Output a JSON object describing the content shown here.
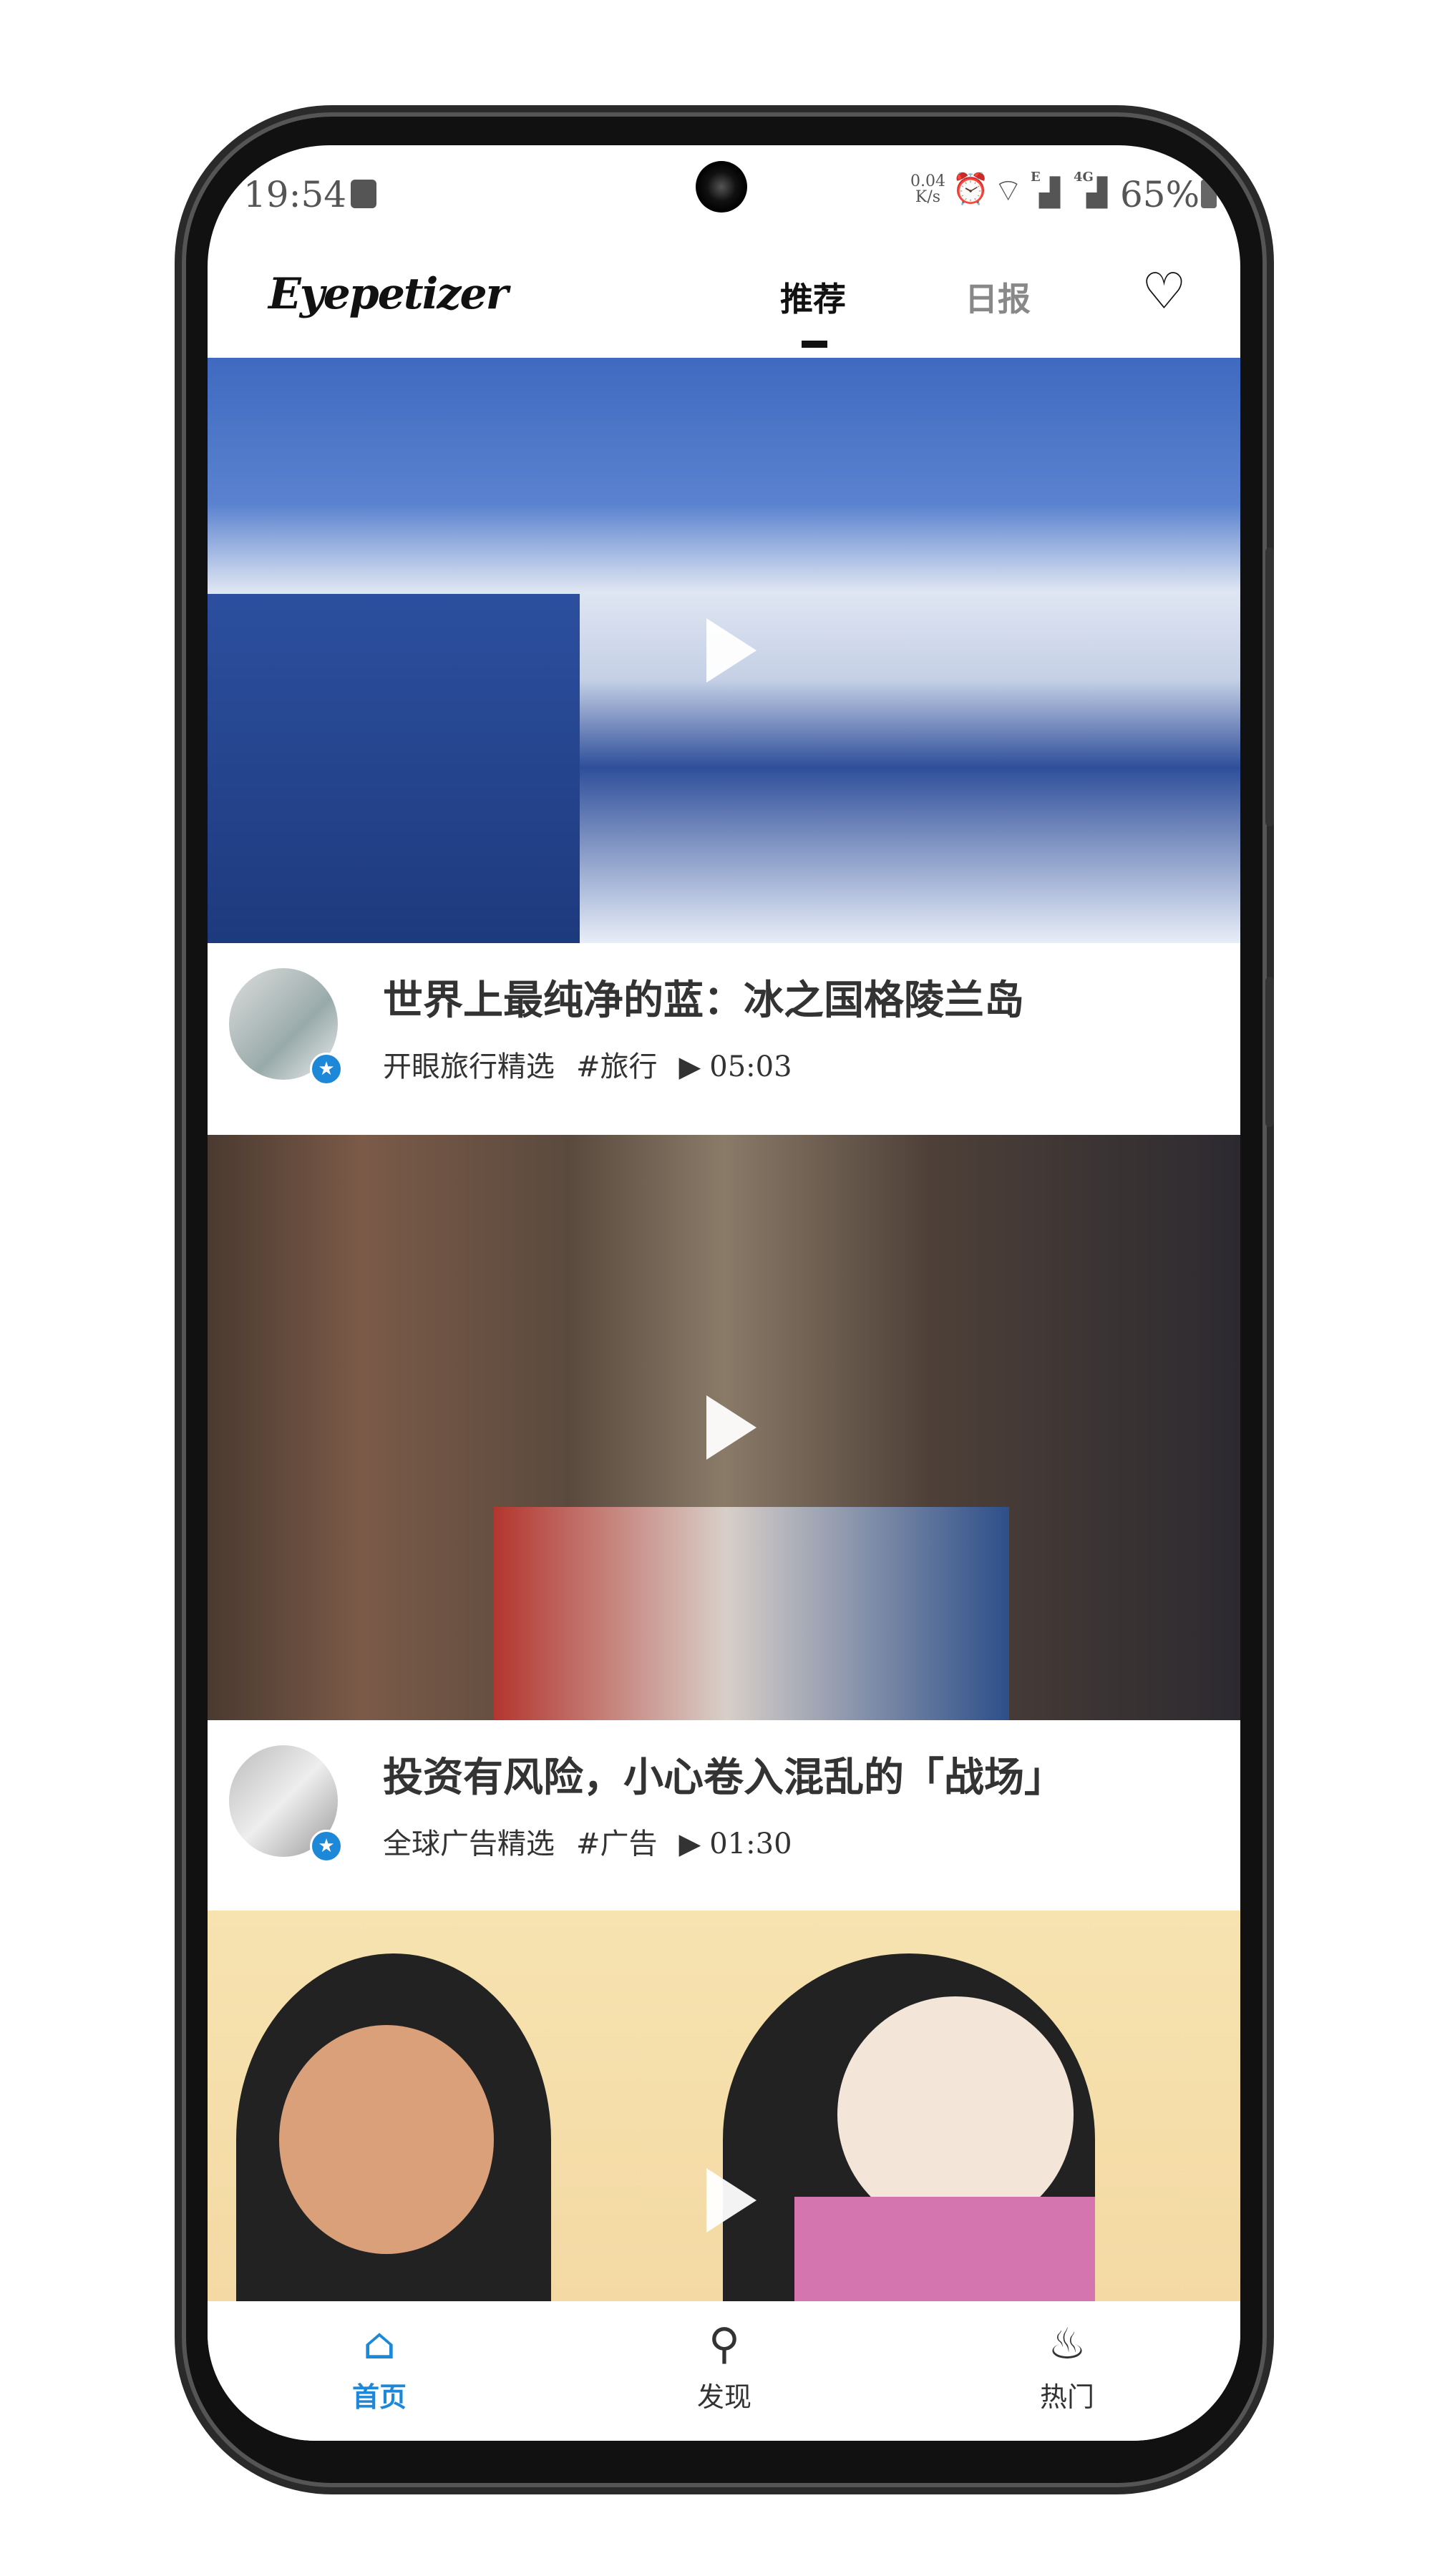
{
  "status_bar": {
    "time": "19:54",
    "net_speed_value": "0.04",
    "net_speed_unit": "K/s",
    "signal_1": "E",
    "signal_2": "4G",
    "battery": "65%"
  },
  "header": {
    "logo": "Eyepetizer",
    "tabs": [
      {
        "label": "推荐",
        "active": true
      },
      {
        "label": "日报",
        "active": false
      }
    ],
    "favorite_icon": "heart-icon"
  },
  "feed": [
    {
      "title": "世界上最纯净的蓝：冰之国格陵兰岛",
      "author": "开眼旅行精选",
      "tag": "#旅行",
      "duration": "05:03"
    },
    {
      "title": "投资有风险，小心卷入混乱的「战场」",
      "author": "全球广告精选",
      "tag": "#广告",
      "duration": "01:30"
    },
    {
      "title": "",
      "author": "",
      "tag": "",
      "duration": ""
    }
  ],
  "bottom_nav": [
    {
      "label": "首页",
      "icon": "home-icon",
      "active": true
    },
    {
      "label": "发现",
      "icon": "search-icon",
      "active": false
    },
    {
      "label": "热门",
      "icon": "fire-icon",
      "active": false
    }
  ],
  "colors": {
    "accent": "#1e88d8",
    "text": "#333333",
    "inactive_tab": "#888888"
  }
}
